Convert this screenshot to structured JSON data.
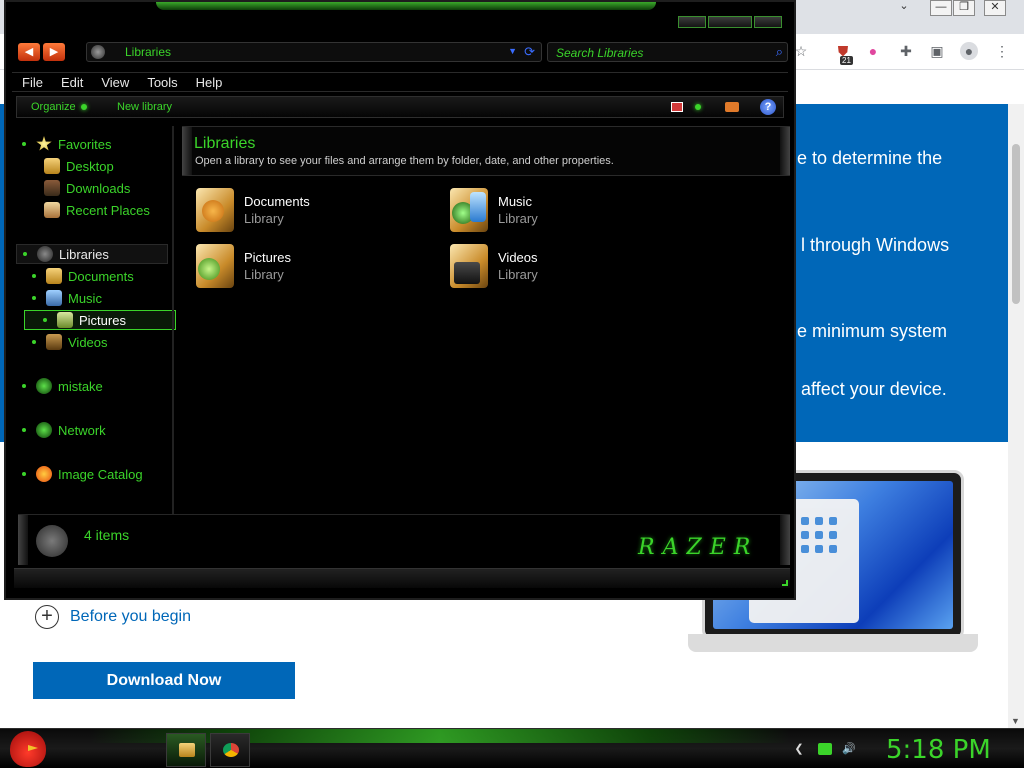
{
  "browser": {
    "window_controls": [
      "⌄",
      "—",
      "❐",
      "✕"
    ],
    "extension_badge": "21",
    "hero_lines": [
      "e to determine the",
      "l through Windows",
      "e minimum system",
      "affect your device."
    ],
    "before_you_begin": "Before you begin",
    "download_button": "Download Now"
  },
  "explorer": {
    "address": "Libraries",
    "search_placeholder": "Search Libraries",
    "menu": [
      "File",
      "Edit",
      "View",
      "Tools",
      "Help"
    ],
    "commands": [
      "Organize",
      "New library"
    ],
    "help_label": "?",
    "nav": {
      "favorites": "Favorites",
      "desktop": "Desktop",
      "downloads": "Downloads",
      "recent": "Recent Places",
      "libraries": "Libraries",
      "documents": "Documents",
      "music": "Music",
      "pictures": "Pictures",
      "videos": "Videos",
      "mistake": "mistake",
      "network": "Network",
      "image_catalog": "Image Catalog"
    },
    "content": {
      "title": "Libraries",
      "subtitle": "Open a library to see your files and arrange them by folder, date, and other properties.",
      "libraries": [
        {
          "name": "Documents",
          "type": "Library"
        },
        {
          "name": "Music",
          "type": "Library"
        },
        {
          "name": "Pictures",
          "type": "Library"
        },
        {
          "name": "Videos",
          "type": "Library"
        }
      ]
    },
    "details": {
      "count": "4 items",
      "brand": "RAZER"
    }
  },
  "taskbar": {
    "clock": "5:18 PM"
  },
  "colors": {
    "accent_green": "#3bd42a",
    "browser_blue": "#0067b8",
    "window_bg": "#000000"
  }
}
